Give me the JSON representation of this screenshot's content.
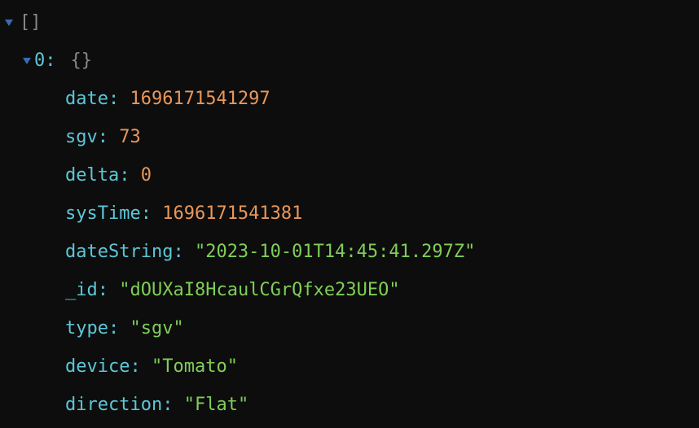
{
  "root": {
    "bracket": "[]"
  },
  "item0": {
    "key": "0",
    "colon": ":",
    "bracket": "{}"
  },
  "entries": {
    "date": {
      "key": "date",
      "colon": ":",
      "value": "1696171541297"
    },
    "sgv": {
      "key": "sgv",
      "colon": ":",
      "value": "73"
    },
    "delta": {
      "key": "delta",
      "colon": ":",
      "value": "0"
    },
    "sysTime": {
      "key": "sysTime",
      "colon": ":",
      "value": "1696171541381"
    },
    "dateString": {
      "key": "dateString",
      "colon": ":",
      "value": "\"2023-10-01T14:45:41.297Z\""
    },
    "_id": {
      "key": "_id",
      "colon": ":",
      "value": "\"dOUXaI8HcaulCGrQfxe23UEO\""
    },
    "type": {
      "key": "type",
      "colon": ":",
      "value": "\"sgv\""
    },
    "device": {
      "key": "device",
      "colon": ":",
      "value": "\"Tomato\""
    },
    "direction": {
      "key": "direction",
      "colon": ":",
      "value": "\"Flat\""
    }
  }
}
